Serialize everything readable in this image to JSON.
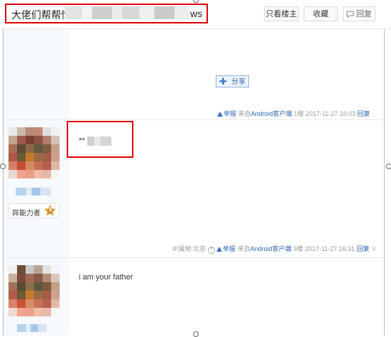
{
  "thread": {
    "title_prefix": "大佬们帮帮忙",
    "title_suffix": "ws"
  },
  "toolbar": {
    "only_op_label": "只看楼主",
    "favorite_label": "收藏",
    "reply_label": "回复"
  },
  "share": {
    "label": "分享"
  },
  "posts": [
    {
      "report_label": "举报",
      "source_prefix": "来自",
      "source_app": "Android客户端",
      "floor": "1楼",
      "time": "2017-11-27 16:03",
      "reply_label": "回复"
    },
    {
      "content_prefix": "**",
      "ip_label": "IP属地:北京",
      "report_label": "举报",
      "source_prefix": "来自",
      "source_app": "Android客户端",
      "floor": "3楼",
      "time": "2017-11-27 16:31",
      "reply_label": "回复",
      "badge_label": "异能力者",
      "badge_level": "6"
    },
    {
      "content": "i am your father"
    }
  ],
  "colors": {
    "highlight_red": "#e00000",
    "link_blue": "#2d64b3",
    "sidebar_bg": "#f6f9fd"
  },
  "icons": {
    "share": "plus-icon",
    "report": "warning-icon",
    "reply": "comment-icon",
    "badge": "star-badge-icon",
    "ip_help": "question-icon",
    "close": "close-icon"
  }
}
